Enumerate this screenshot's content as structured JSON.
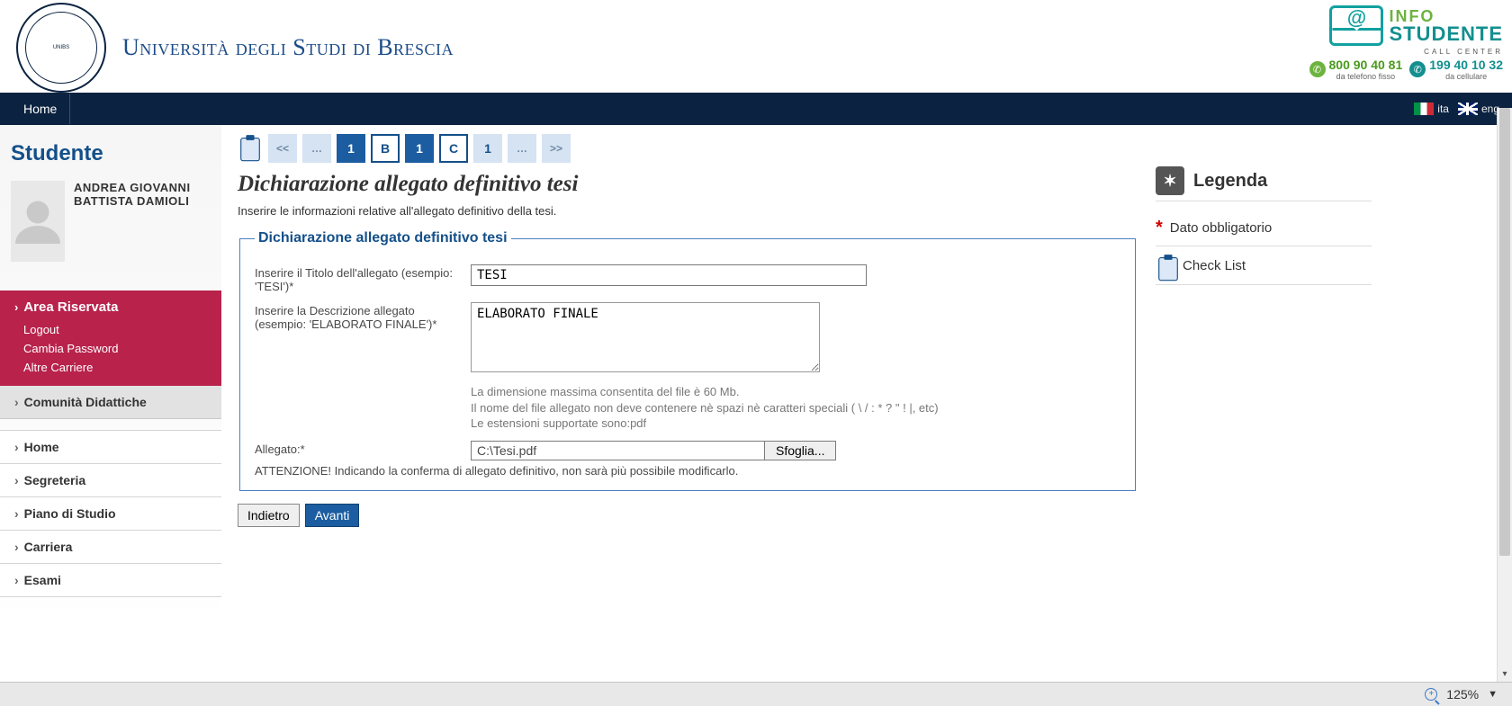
{
  "header": {
    "university_name": "Università degli Studi di Brescia",
    "info_top": "INFO",
    "info_bottom": "STUDENTE",
    "callcenter": "CALL CENTER",
    "phone1": "800 90 40 81",
    "phone1_sub": "da telefono fisso",
    "phone2": "199 40 10 32",
    "phone2_sub": "da cellulare"
  },
  "nav": {
    "home": "Home",
    "lang_it": "ita",
    "lang_en": "eng"
  },
  "sidebar": {
    "heading": "Studente",
    "user_name": "ANDREA GIOVANNI BATTISTA DAMIOLI",
    "area_title": "Area Riservata",
    "area_links": [
      "Logout",
      "Cambia Password",
      "Altre Carriere"
    ],
    "comunita": "Comunità Didattiche",
    "menu": [
      "Home",
      "Segreteria",
      "Piano di Studio",
      "Carriera",
      "Esami"
    ]
  },
  "wizard": {
    "steps": [
      "<<",
      "…",
      "1",
      "B",
      "1",
      "C",
      "1",
      "…",
      ">>"
    ]
  },
  "page": {
    "title": "Dichiarazione allegato definitivo tesi",
    "subtitle": "Inserire le informazioni relative all'allegato definitivo della tesi.",
    "fieldset_legend": "Dichiarazione allegato definitivo tesi",
    "label_title": "Inserire il Titolo dell'allegato (esempio: 'TESI')*",
    "value_title": "TESI",
    "label_desc": "Inserire la Descrizione allegato (esempio: 'ELABORATO FINALE')*",
    "value_desc": "ELABORATO FINALE",
    "helper1": "La dimensione massima consentita del file è 60 Mb.",
    "helper2": "Il nome del file allegato non deve contenere nè spazi nè caratteri speciali ( \\ / : * ? \" ! |, etc)",
    "helper3": "Le estensioni supportate sono:pdf",
    "label_file": "Allegato:*",
    "file_path": "C:\\Tesi.pdf",
    "browse": "Sfoglia...",
    "warning": "ATTENZIONE! Indicando la conferma di allegato definitivo, non sarà più possibile modificarlo.",
    "btn_back": "Indietro",
    "btn_next": "Avanti"
  },
  "legenda": {
    "title": "Legenda",
    "item_required": "Dato obbligatorio",
    "item_checklist": "Check List"
  },
  "status": {
    "zoom": "125%"
  }
}
